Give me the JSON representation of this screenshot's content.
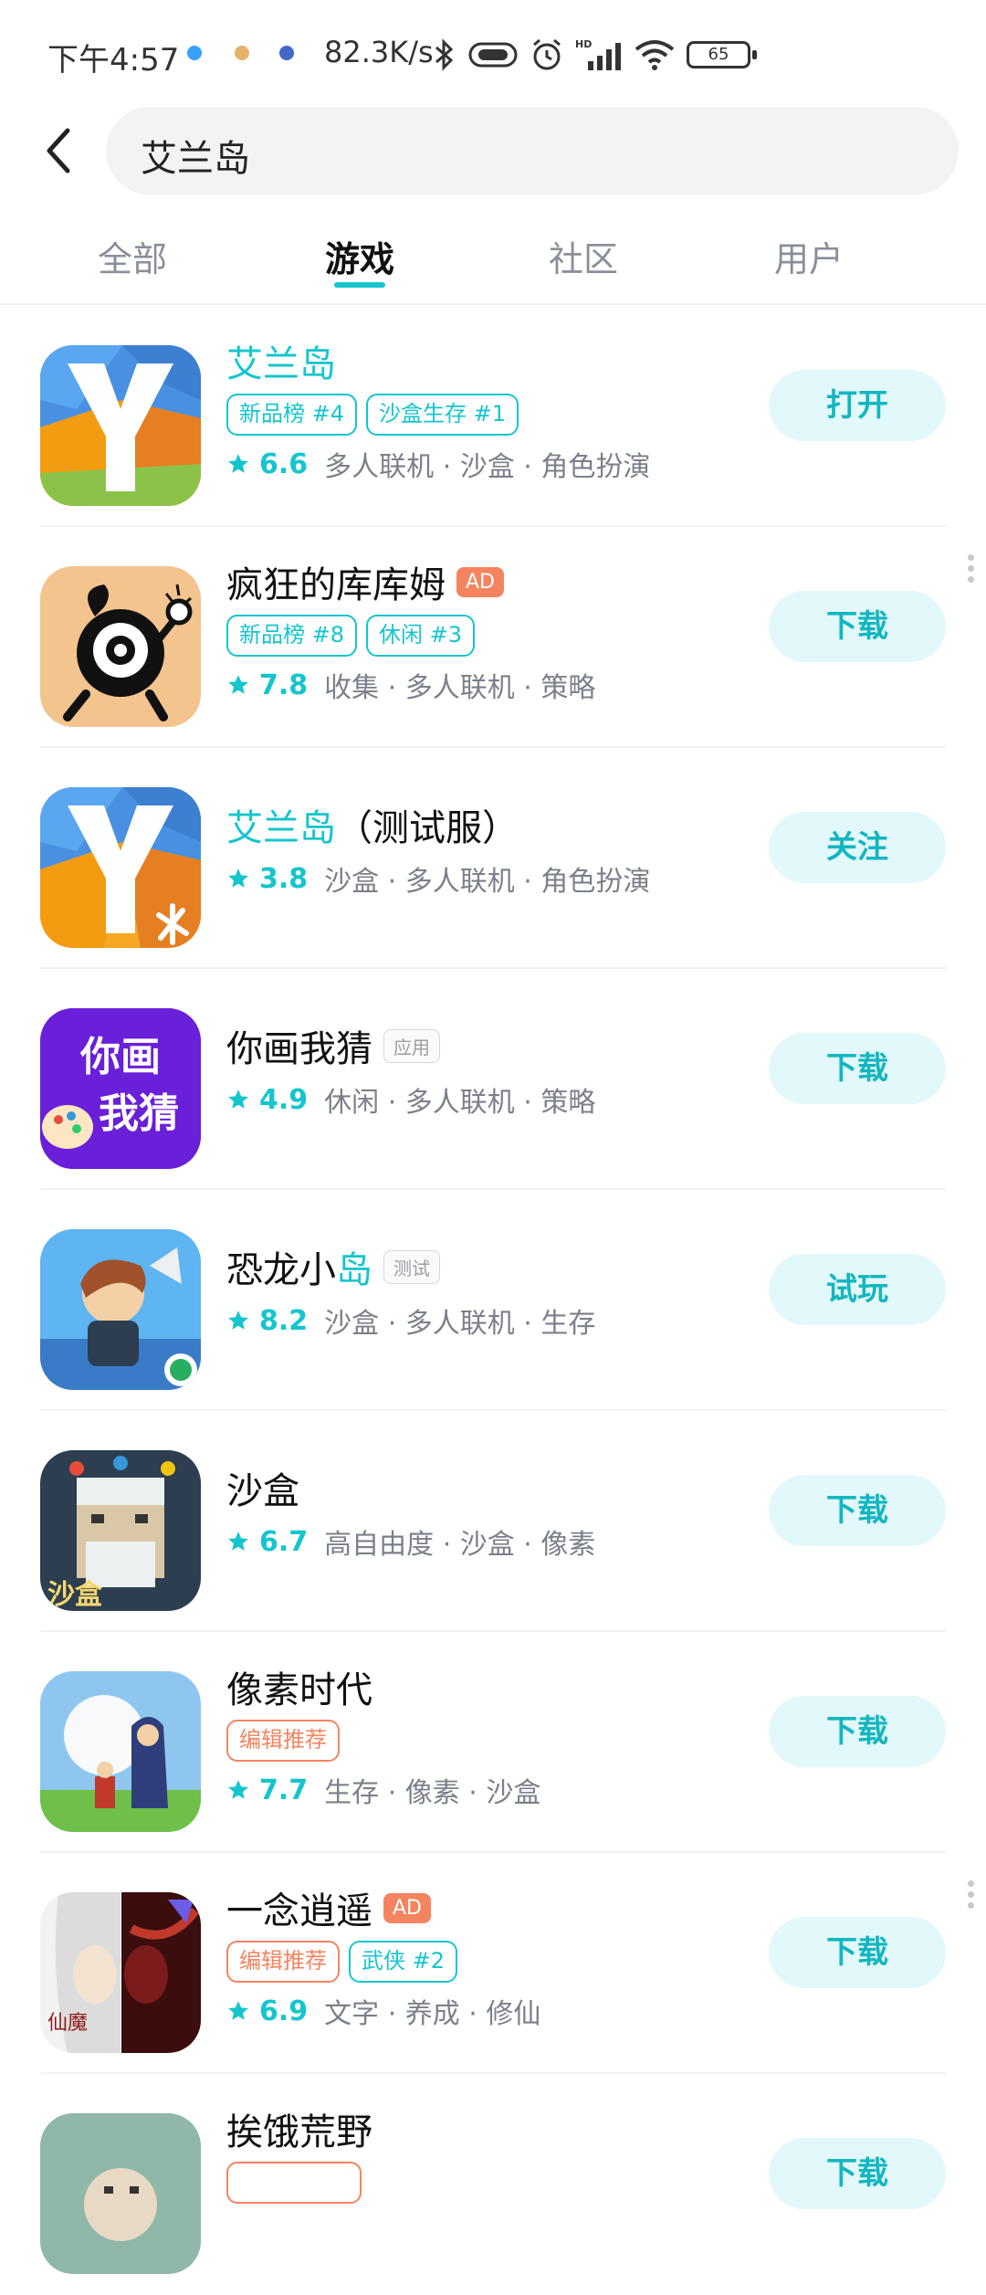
{
  "status_bar": {
    "time": "下午4:57",
    "network_speed": "82.3K/s",
    "battery": "65",
    "icons": [
      "app-notification-icon",
      "app-notification-icon",
      "app-notification-icon",
      "bluetooth-icon",
      "vibrate-icon",
      "alarm-icon",
      "hd-signal-icon",
      "wifi-icon",
      "battery-icon"
    ]
  },
  "search": {
    "query": "艾兰岛",
    "back_icon": "chevron-left-icon"
  },
  "tabs": [
    {
      "label": "全部",
      "active": false
    },
    {
      "label": "游戏",
      "active": true
    },
    {
      "label": "社区",
      "active": false
    },
    {
      "label": "用户",
      "active": false
    }
  ],
  "accent_color": "#15c5ce",
  "results": [
    {
      "name_highlight": "艾兰岛",
      "name_rest": "",
      "ad_badge": "",
      "type_badge": "",
      "tags": [
        {
          "text": "新品榜 #4",
          "style": "teal"
        },
        {
          "text": "沙盒生存 #1",
          "style": "teal"
        }
      ],
      "rating": "6.6",
      "categories": "多人联机 · 沙盒 · 角色扮演",
      "action": "打开",
      "more": false
    },
    {
      "name_highlight": "",
      "name_rest": "疯狂的库库姆",
      "ad_badge": "AD",
      "type_badge": "",
      "tags": [
        {
          "text": "新品榜 #8",
          "style": "teal"
        },
        {
          "text": "休闲 #3",
          "style": "teal"
        }
      ],
      "rating": "7.8",
      "categories": "收集 · 多人联机 · 策略",
      "action": "下载",
      "more": true
    },
    {
      "name_highlight": "艾兰岛",
      "name_rest": "（测试服）",
      "ad_badge": "",
      "type_badge": "",
      "tags": [],
      "rating": "3.8",
      "categories": "沙盒 · 多人联机 · 角色扮演",
      "action": "关注",
      "more": false
    },
    {
      "name_highlight": "",
      "name_rest": "你画我猜",
      "ad_badge": "",
      "type_badge": "应用",
      "tags": [],
      "rating": "4.9",
      "categories": "休闲 · 多人联机 · 策略",
      "action": "下载",
      "more": false
    },
    {
      "name_highlight": "",
      "name_rest": "恐龙小",
      "name_tail_highlight": "岛",
      "ad_badge": "",
      "type_badge": "测试",
      "tags": [],
      "rating": "8.2",
      "categories": "沙盒 · 多人联机 · 生存",
      "action": "试玩",
      "more": false
    },
    {
      "name_highlight": "",
      "name_rest": "沙盒",
      "ad_badge": "",
      "type_badge": "",
      "tags": [],
      "rating": "6.7",
      "categories": "高自由度 · 沙盒 · 像素",
      "action": "下载",
      "more": false
    },
    {
      "name_highlight": "",
      "name_rest": "像素时代",
      "ad_badge": "",
      "type_badge": "",
      "tags": [
        {
          "text": "编辑推荐",
          "style": "orange"
        }
      ],
      "rating": "7.7",
      "categories": "生存 · 像素 · 沙盒",
      "action": "下载",
      "more": false
    },
    {
      "name_highlight": "",
      "name_rest": "一念逍遥",
      "ad_badge": "AD",
      "type_badge": "",
      "tags": [
        {
          "text": "编辑推荐",
          "style": "orange"
        },
        {
          "text": "武侠 #2",
          "style": "teal"
        }
      ],
      "rating": "6.9",
      "categories": "文字 · 养成 · 修仙",
      "action": "下载",
      "more": true
    },
    {
      "name_highlight": "",
      "name_rest": "挨饿荒野",
      "ad_badge": "",
      "type_badge": "",
      "tags": [],
      "rating": "",
      "categories": "",
      "action": "下载",
      "more": false
    }
  ],
  "icon_labels": {
    "ni_hua_wo_cai": [
      "你画",
      "我猜"
    ],
    "sandbox": "沙盒",
    "yinian": "仙魔"
  }
}
